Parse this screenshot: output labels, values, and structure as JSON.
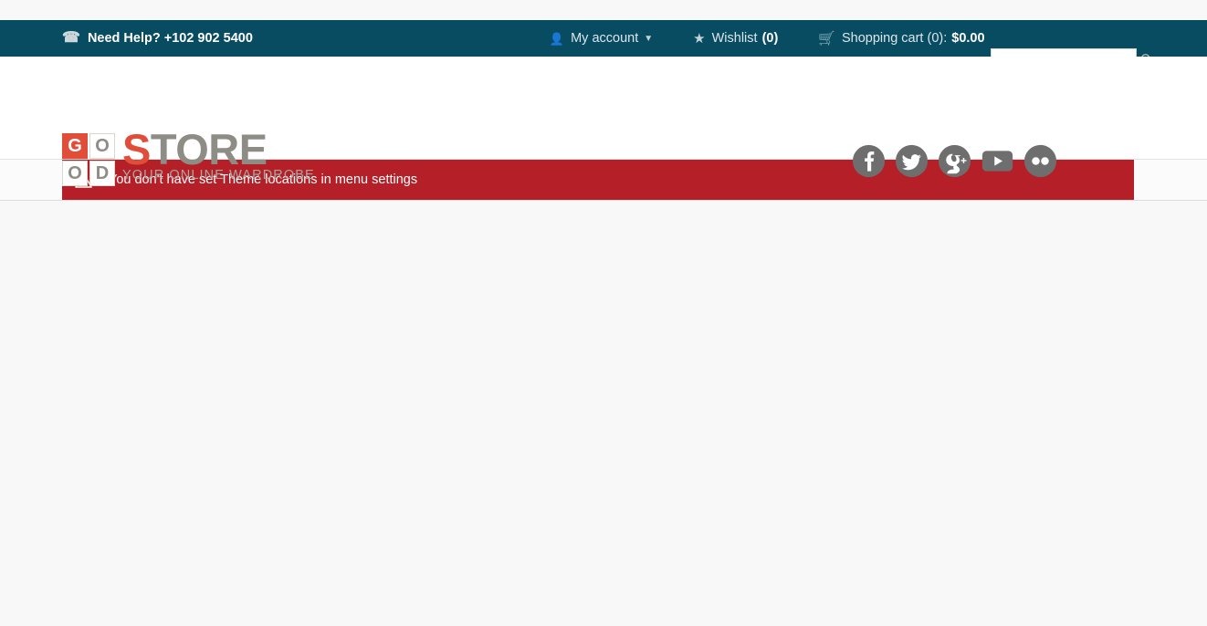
{
  "topbar": {
    "help_icon": "phone-icon",
    "help_text": "Need Help? +102 902 5400",
    "account": {
      "icon": "user-icon",
      "label": "My account",
      "caret": "chevron-down-icon"
    },
    "wishlist": {
      "icon": "star-icon",
      "label": "Wishlist",
      "count": "(0)"
    },
    "cart": {
      "icon": "cart-icon",
      "label": "Shopping cart (0):",
      "total": "$0.00"
    },
    "search": {
      "value": "",
      "placeholder": "",
      "icon": "search-icon"
    }
  },
  "header": {
    "logo": {
      "cells": [
        "G",
        "O",
        "O",
        "D"
      ],
      "word_accent": "S",
      "word_rest": "TORE",
      "tagline": "YOUR ONLINE WARDROBE"
    },
    "social": [
      {
        "name": "facebook-icon",
        "label": "Facebook"
      },
      {
        "name": "twitter-icon",
        "label": "Twitter"
      },
      {
        "name": "google-plus-icon",
        "label": "Google Plus"
      },
      {
        "name": "youtube-icon",
        "label": "YouTube"
      },
      {
        "name": "flickr-icon",
        "label": "Flickr"
      }
    ]
  },
  "alert": {
    "icon": "warning-triangle-icon",
    "message": "You don't have set Theme locations in menu settings"
  },
  "colors": {
    "topbar_bg": "#084c62",
    "alert_bg": "#b51f27",
    "logo_red": "#e04e39",
    "logo_grey": "#8d8d86",
    "social_grey": "#6e6e6e",
    "page_bg": "#f8f8f8"
  }
}
